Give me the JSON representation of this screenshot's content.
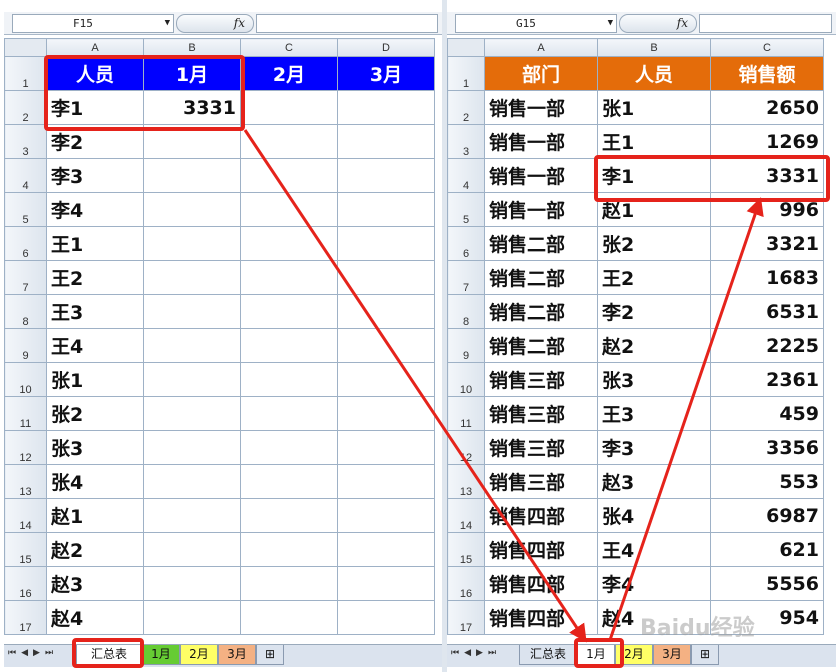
{
  "left": {
    "name_box": "F15",
    "fx_label": "fx",
    "col_headers": [
      "A",
      "B",
      "C",
      "D"
    ],
    "rows": [
      {
        "num": "1",
        "cells": [
          "人员",
          "1月",
          "2月",
          "3月"
        ]
      },
      {
        "num": "2",
        "cells": [
          "李1",
          "3331",
          "",
          ""
        ]
      },
      {
        "num": "3",
        "cells": [
          "李2",
          "",
          "",
          ""
        ]
      },
      {
        "num": "4",
        "cells": [
          "李3",
          "",
          "",
          ""
        ]
      },
      {
        "num": "5",
        "cells": [
          "李4",
          "",
          "",
          ""
        ]
      },
      {
        "num": "6",
        "cells": [
          "王1",
          "",
          "",
          ""
        ]
      },
      {
        "num": "7",
        "cells": [
          "王2",
          "",
          "",
          ""
        ]
      },
      {
        "num": "8",
        "cells": [
          "王3",
          "",
          "",
          ""
        ]
      },
      {
        "num": "9",
        "cells": [
          "王4",
          "",
          "",
          ""
        ]
      },
      {
        "num": "10",
        "cells": [
          "张1",
          "",
          "",
          ""
        ]
      },
      {
        "num": "11",
        "cells": [
          "张2",
          "",
          "",
          ""
        ]
      },
      {
        "num": "12",
        "cells": [
          "张3",
          "",
          "",
          ""
        ]
      },
      {
        "num": "13",
        "cells": [
          "张4",
          "",
          "",
          ""
        ]
      },
      {
        "num": "14",
        "cells": [
          "赵1",
          "",
          "",
          ""
        ]
      },
      {
        "num": "15",
        "cells": [
          "赵2",
          "",
          "",
          ""
        ]
      },
      {
        "num": "16",
        "cells": [
          "赵3",
          "",
          "",
          ""
        ]
      },
      {
        "num": "17",
        "cells": [
          "赵4",
          "",
          "",
          ""
        ]
      }
    ],
    "tabs": [
      "汇总表",
      "1月",
      "2月",
      "3月"
    ],
    "active_tab": "汇总表"
  },
  "right": {
    "name_box": "G15",
    "fx_label": "fx",
    "col_headers": [
      "A",
      "B",
      "C"
    ],
    "rows": [
      {
        "num": "1",
        "cells": [
          "部门",
          "人员",
          "销售额"
        ]
      },
      {
        "num": "2",
        "cells": [
          "销售一部",
          "张1",
          "2650"
        ]
      },
      {
        "num": "3",
        "cells": [
          "销售一部",
          "王1",
          "1269"
        ]
      },
      {
        "num": "4",
        "cells": [
          "销售一部",
          "李1",
          "3331"
        ]
      },
      {
        "num": "5",
        "cells": [
          "销售一部",
          "赵1",
          "996"
        ]
      },
      {
        "num": "6",
        "cells": [
          "销售二部",
          "张2",
          "3321"
        ]
      },
      {
        "num": "7",
        "cells": [
          "销售二部",
          "王2",
          "1683"
        ]
      },
      {
        "num": "8",
        "cells": [
          "销售二部",
          "李2",
          "6531"
        ]
      },
      {
        "num": "9",
        "cells": [
          "销售二部",
          "赵2",
          "2225"
        ]
      },
      {
        "num": "10",
        "cells": [
          "销售三部",
          "张3",
          "2361"
        ]
      },
      {
        "num": "11",
        "cells": [
          "销售三部",
          "王3",
          "459"
        ]
      },
      {
        "num": "12",
        "cells": [
          "销售三部",
          "李3",
          "3356"
        ]
      },
      {
        "num": "13",
        "cells": [
          "销售三部",
          "赵3",
          "553"
        ]
      },
      {
        "num": "14",
        "cells": [
          "销售四部",
          "张4",
          "6987"
        ]
      },
      {
        "num": "15",
        "cells": [
          "销售四部",
          "王4",
          "621"
        ]
      },
      {
        "num": "16",
        "cells": [
          "销售四部",
          "李4",
          "5556"
        ]
      },
      {
        "num": "17",
        "cells": [
          "销售四部",
          "赵4",
          "954"
        ]
      }
    ],
    "tabs": [
      "汇总表",
      "1月",
      "2月",
      "3月"
    ],
    "active_tab": "1月"
  },
  "colors": {
    "header_blue": "#0000ff",
    "header_orange": "#e46c0a",
    "highlight_red": "#e5231b",
    "tab_green": "#66cc33",
    "tab_yellow": "#ffff66",
    "tab_orange": "#f4b183"
  },
  "watermark": "Baidu经验"
}
